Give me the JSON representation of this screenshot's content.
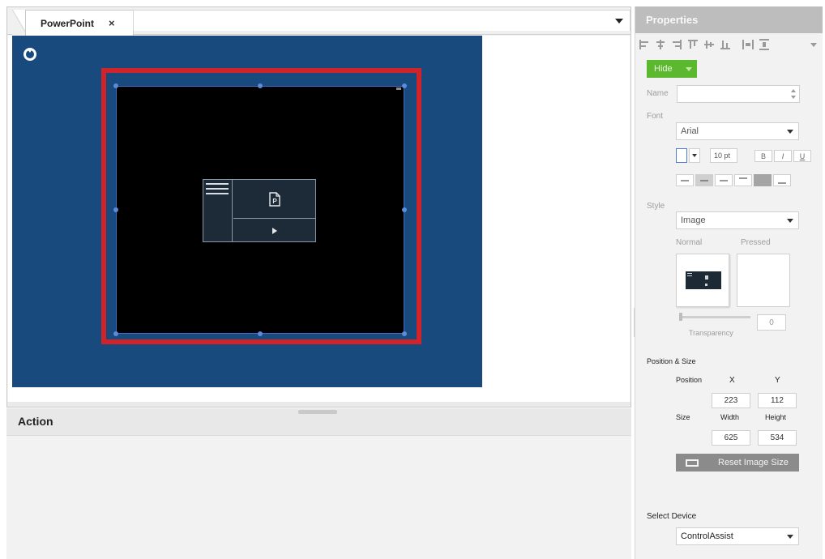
{
  "editor": {
    "tab_title": "PowerPoint",
    "tab_close_glyph": "×",
    "tab_dropdown_icon": "triangle-down-icon"
  },
  "slide": {
    "background_color": "#194a7d",
    "highlight_color": "#d1232a",
    "logo_icon": "brand-logo-icon",
    "widget_icons": [
      "menu-lines-icon",
      "powerpoint-file-icon",
      "play-icon"
    ],
    "file_glyph": "P",
    "play_glyph": "▶"
  },
  "action": {
    "title": "Action"
  },
  "properties": {
    "title": "Properties",
    "hide_button": "Hide",
    "name_label": "Name",
    "name_value": "",
    "font_label": "Font",
    "font_value": "Arial",
    "font_size": "10 pt",
    "bold_label": "B",
    "italic_label": "I",
    "underline_label": "U",
    "style_label": "Style",
    "style_value": "Image",
    "normal_label": "Normal",
    "pressed_label": "Pressed",
    "transparency_label": "Transparency",
    "transparency_value": "0",
    "position_size_label": "Position & Size",
    "position_label": "Position",
    "size_label": "Size",
    "x_label": "X",
    "y_label": "Y",
    "width_label": "Width",
    "height_label": "Height",
    "x_value": "223",
    "y_value": "112",
    "width_value": "625",
    "height_value": "534",
    "reset_button": "Reset Image Size",
    "select_device_label": "Select Device",
    "device_value": "ControlAssist",
    "hide_color": "#5cb82e"
  }
}
